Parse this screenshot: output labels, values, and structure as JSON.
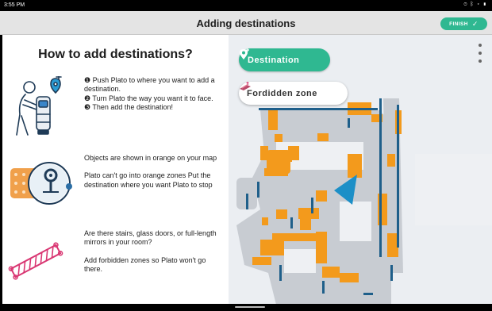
{
  "status_bar": {
    "time": "3:55 PM",
    "icons": [
      "location-icon",
      "bluetooth-icon",
      "wifi-icon",
      "battery-icon"
    ]
  },
  "header": {
    "title": "Adding destinations",
    "finish_label": "FINISH"
  },
  "guide": {
    "title": "How to add destinations?",
    "sections": [
      {
        "icon": "push-robot-illustration",
        "lines": [
          "❶ Push Plato to where you want to add a destination.",
          "❷ Turn Plato the way you want it to face.",
          "❸ Then add the destination!"
        ]
      },
      {
        "icon": "orange-objects-illustration",
        "paragraphs": [
          "Objects are shown in orange on your map",
          "Plato can't go into orange zones Put the destination where you want Plato to stop"
        ]
      },
      {
        "icon": "forbidden-zone-illustration",
        "paragraphs": [
          "Are there stairs, glass doors, or full-length mirrors in your room?",
          "Add forbidden zones so Plato won't go there."
        ]
      }
    ]
  },
  "map": {
    "destination_label": "Destination",
    "forbidden_label": "Fordidden zone",
    "colors": {
      "accent": "#2fb891",
      "obstacle": "#f39a1c",
      "wall": "#1f5f8a",
      "robot": "#1c8fc7",
      "free": "#c8ccd2",
      "background": "#ebeef2"
    }
  }
}
